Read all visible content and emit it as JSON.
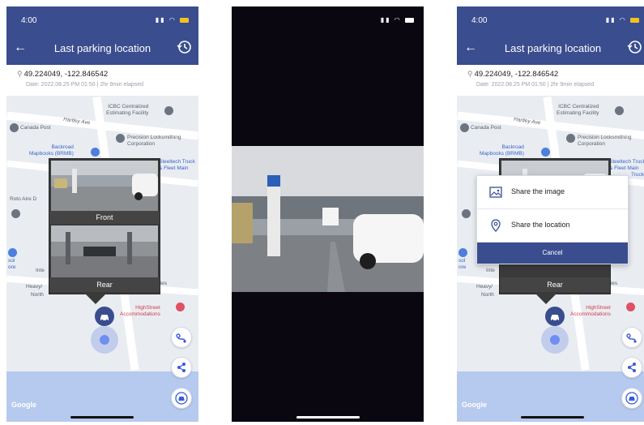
{
  "status": {
    "time": "4:00"
  },
  "header": {
    "title": "Last parking location"
  },
  "location": {
    "coords": "49.224049, -122.846542",
    "date": "Date: 2022.08.25 PM 01:50",
    "elapsed": "2hr 9min elapsed"
  },
  "map": {
    "labels": {
      "icbc": "ICBC Centralized\nEstimating Facility",
      "canada_post": "Canada Post",
      "hartley": "Hartley Ave",
      "precision": "Precision Locksmithing\nCorporation",
      "backroad": "Backroad\nMapbooks (BRMB)",
      "steeltech": "Steeltech Truck\n& Fleet Main",
      "truck": "Truck",
      "roto": "Roto Aire D",
      "sol": "sol\nore",
      "inte": "Inte",
      "heavy": "Heavy/",
      "north": "North",
      "ties": "ties",
      "highstreet": "HighStreet\nAccommodations",
      "google": "Google"
    }
  },
  "photos": {
    "front": "Front",
    "rear": "Rear"
  },
  "share": {
    "image": "Share the image",
    "location": "Share the location",
    "cancel": "Cancel"
  },
  "icons": {
    "back": "back-arrow-icon",
    "history": "history-icon",
    "pin": "location-pin-icon",
    "car": "car-icon",
    "route": "route-icon",
    "share": "share-icon",
    "recenter": "recenter-car-icon",
    "image": "image-icon"
  },
  "colors": {
    "header": "#3a4d8f",
    "accent": "#4f7fdc",
    "battery": "#f0c419",
    "cancel": "#3a4d8f"
  }
}
